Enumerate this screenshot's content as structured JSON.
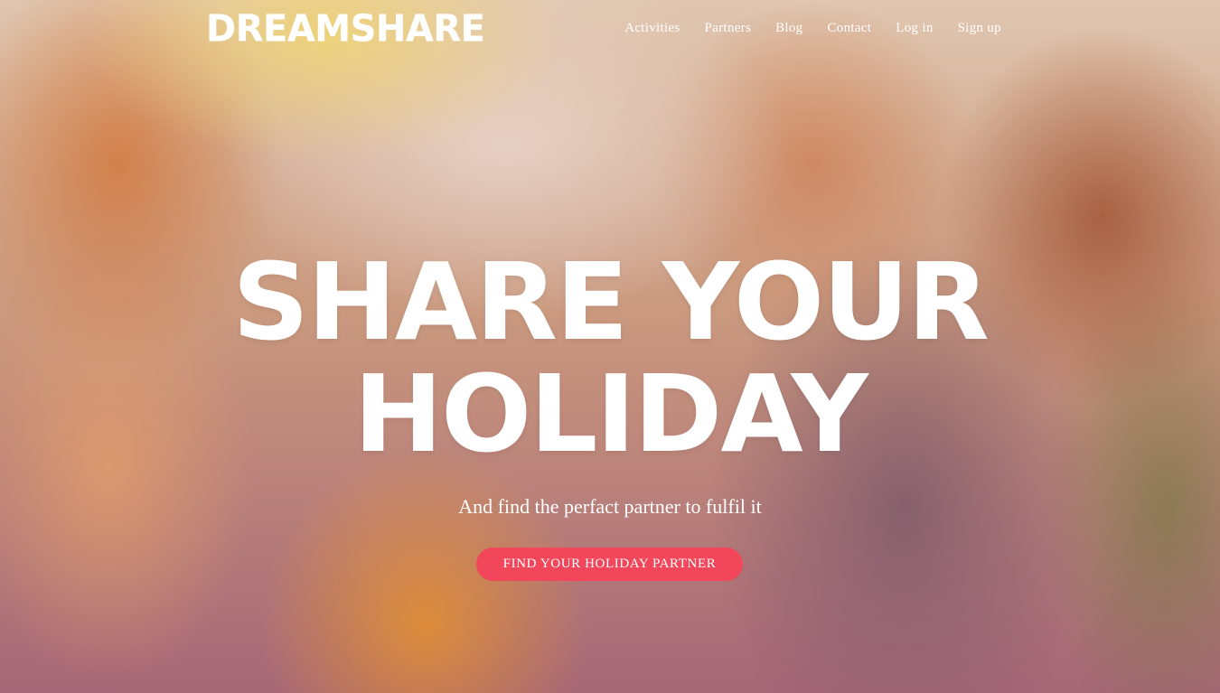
{
  "brand": {
    "logo_text": "DREAMSHARE"
  },
  "nav": {
    "items": [
      {
        "label": "Activities"
      },
      {
        "label": "Partners"
      },
      {
        "label": "Blog"
      },
      {
        "label": "Contact"
      },
      {
        "label": "Log in"
      },
      {
        "label": "Sign up"
      }
    ]
  },
  "hero": {
    "headline_line1": "SHARE YOUR",
    "headline_line2": "HOLIDAY",
    "subtitle": "And find the perfact partner to fulfil it",
    "cta_label": "FIND YOUR HOLIDAY PARTNER"
  },
  "colors": {
    "accent": "#f2475a",
    "text": "#ffffff"
  }
}
